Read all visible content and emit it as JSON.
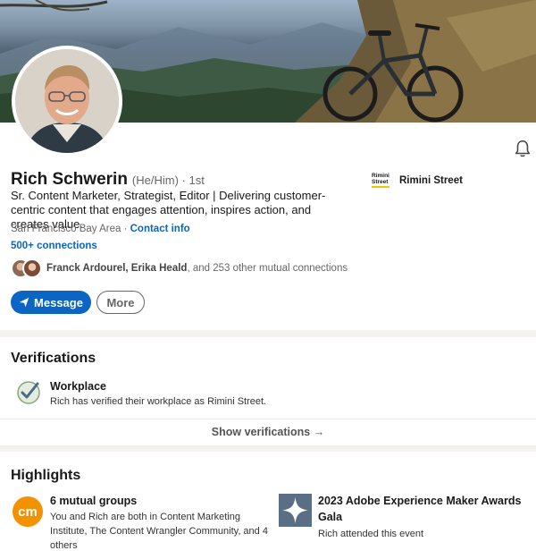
{
  "profile": {
    "name": "Rich Schwerin",
    "pronouns": "(He/Him)",
    "degree": "· 1st",
    "headline": "Sr. Content Marketer, Strategist, Editor | Delivering customer-centric content that engages attention, inspires action, and creates value.",
    "location": "San Francisco Bay Area",
    "location_separator": " · ",
    "contact_info": "Contact info",
    "connections": "500+ connections",
    "mutual_names": "Franck Ardourel, Erika Heald",
    "mutual_rest": ", and 253 other mutual connections",
    "message_button": "Message",
    "more_button": "More"
  },
  "company": {
    "logo_line1": "Rimini",
    "logo_line2": "Street",
    "name": "Rimini Street"
  },
  "verifications": {
    "title": "Verifications",
    "item_title": "Workplace",
    "item_desc": "Rich has verified their workplace as Rimini Street.",
    "show_link": "Show verifications →"
  },
  "highlights": {
    "title": "Highlights",
    "groups_icon_text": "cm",
    "groups_title": "6 mutual groups",
    "groups_desc_line1": "You and Rich are both in Content Marketing",
    "groups_desc_line2": "Institute, The Content Wrangler Community, and 4",
    "groups_desc_line3": "others",
    "event_title_line1": "2023 Adobe Experience Maker Awards",
    "event_title_line2": "Gala",
    "event_desc": "Rich attended this event"
  },
  "colors": {
    "accent": "#0a66c2",
    "verified_green": "#4a8a2a",
    "groups_orange": "#f39200",
    "event_slate": "#5a6e85"
  },
  "icons": [
    "bell-icon",
    "send-icon",
    "verified-check-icon",
    "groups-logo-icon",
    "event-star-icon"
  ]
}
